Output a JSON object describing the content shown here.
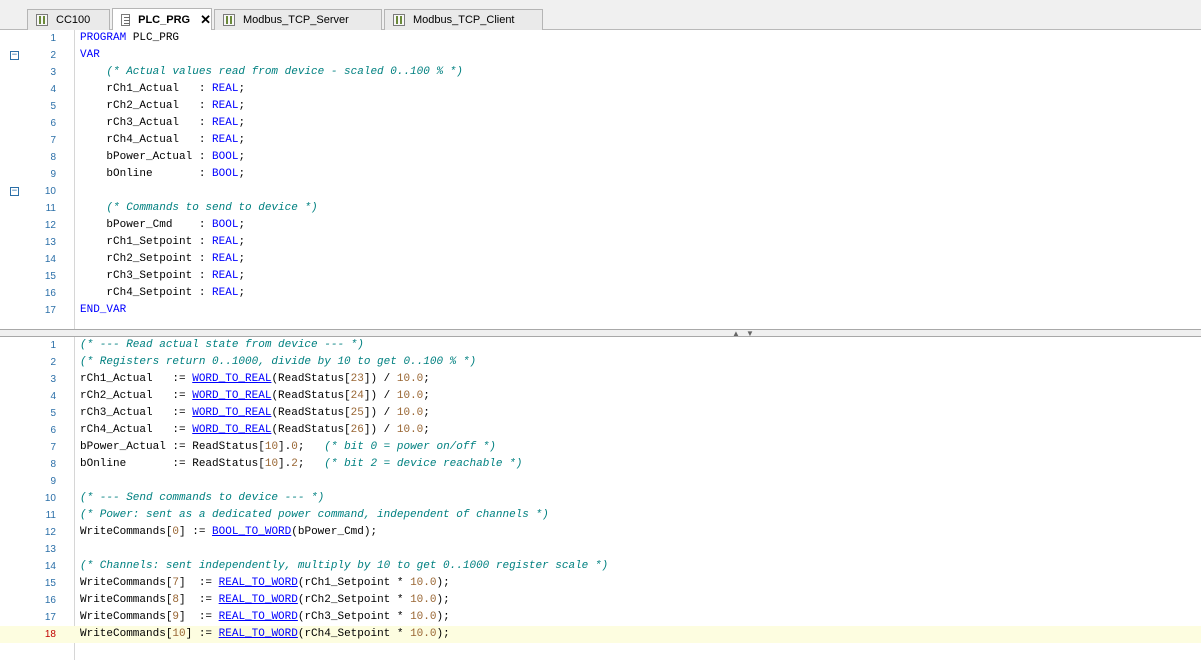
{
  "tabs": [
    {
      "label": "CC100",
      "kind": "device"
    },
    {
      "label": "PLC_PRG",
      "kind": "doc",
      "close": "✕"
    },
    {
      "label": "Modbus_TCP_Server",
      "kind": "device"
    },
    {
      "label": "Modbus_TCP_Client",
      "kind": "device"
    }
  ],
  "decl": {
    "lines": [
      {
        "n": "1",
        "t": "PROGRAM PLC_PRG"
      },
      {
        "n": "2",
        "t": "VAR"
      },
      {
        "n": "3",
        "t": "    (* Actual values read from device - scaled 0..100 % *)"
      },
      {
        "n": "4",
        "t": "    rCh1_Actual   : REAL;"
      },
      {
        "n": "5",
        "t": "    rCh2_Actual   : REAL;"
      },
      {
        "n": "6",
        "t": "    rCh3_Actual   : REAL;"
      },
      {
        "n": "7",
        "t": "    rCh4_Actual   : REAL;"
      },
      {
        "n": "8",
        "t": "    bPower_Actual : BOOL;"
      },
      {
        "n": "9",
        "t": "    bOnline       : BOOL;"
      },
      {
        "n": "10",
        "t": ""
      },
      {
        "n": "11",
        "t": "    (* Commands to send to device *)"
      },
      {
        "n": "12",
        "t": "    bPower_Cmd    : BOOL;"
      },
      {
        "n": "13",
        "t": "    rCh1_Setpoint : REAL;"
      },
      {
        "n": "14",
        "t": "    rCh2_Setpoint : REAL;"
      },
      {
        "n": "15",
        "t": "    rCh3_Setpoint : REAL;"
      },
      {
        "n": "16",
        "t": "    rCh4_Setpoint : REAL;"
      },
      {
        "n": "17",
        "t": "END_VAR"
      }
    ]
  },
  "impl": {
    "lines": [
      {
        "n": "1",
        "t": "(* --- Read actual state from device --- *)"
      },
      {
        "n": "2",
        "t": "(* Registers return 0..1000, divide by 10 to get 0..100 % *)"
      },
      {
        "n": "3",
        "t": "rCh1_Actual   := WORD_TO_REAL(ReadStatus[23]) / 10.0;"
      },
      {
        "n": "4",
        "t": "rCh2_Actual   := WORD_TO_REAL(ReadStatus[24]) / 10.0;"
      },
      {
        "n": "5",
        "t": "rCh3_Actual   := WORD_TO_REAL(ReadStatus[25]) / 10.0;"
      },
      {
        "n": "6",
        "t": "rCh4_Actual   := WORD_TO_REAL(ReadStatus[26]) / 10.0;"
      },
      {
        "n": "7",
        "t": "bPower_Actual := ReadStatus[10].0;   (* bit 0 = power on/off *)"
      },
      {
        "n": "8",
        "t": "bOnline       := ReadStatus[10].2;   (* bit 2 = device reachable *)"
      },
      {
        "n": "9",
        "t": ""
      },
      {
        "n": "10",
        "t": "(* --- Send commands to device --- *)"
      },
      {
        "n": "11",
        "t": "(* Power: sent as a dedicated power command, independent of channels *)"
      },
      {
        "n": "12",
        "t": "WriteCommands[0] := BOOL_TO_WORD(bPower_Cmd);"
      },
      {
        "n": "13",
        "t": ""
      },
      {
        "n": "14",
        "t": "(* Channels: sent independently, multiply by 10 to get 0..1000 register scale *)"
      },
      {
        "n": "15",
        "t": "WriteCommands[7]  := REAL_TO_WORD(rCh1_Setpoint * 10.0);"
      },
      {
        "n": "16",
        "t": "WriteCommands[8]  := REAL_TO_WORD(rCh2_Setpoint * 10.0);"
      },
      {
        "n": "17",
        "t": "WriteCommands[9]  := REAL_TO_WORD(rCh3_Setpoint * 10.0);"
      },
      {
        "n": "18",
        "t": "WriteCommands[10] := REAL_TO_WORD(rCh4_Setpoint * 10.0);"
      }
    ],
    "current_line": "18"
  },
  "splitter": {
    "up": "▲",
    "down": "▼"
  },
  "fold_glyph": "−"
}
